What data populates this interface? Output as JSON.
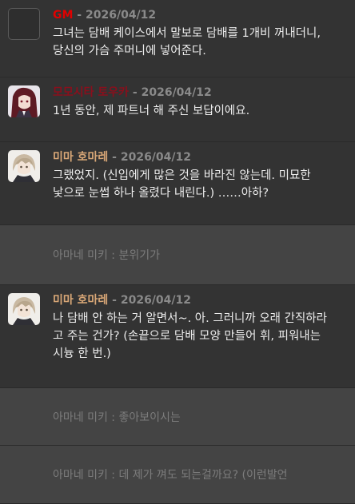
{
  "messages": [
    {
      "kind": "chat",
      "speaker": "GM",
      "speaker_color": "#e10000",
      "timestamp": " - 2026/04/12",
      "text": "그녀는 담배 케이스에서 말보로 담배를 1개비 꺼내더니,\n당신의 가슴 주머니에 넣어준다.",
      "avatar": "gm-avatar-box",
      "height": 97
    },
    {
      "kind": "chat",
      "speaker": "모모시타 토우카",
      "speaker_color": "#8a0f1c",
      "timestamp": " - 2026/04/12",
      "text": "1년 동안, 제 파트너 해 주신 보답이에요.",
      "avatar": "dark-red-hair-woman-avatar",
      "height": 81
    },
    {
      "kind": "chat",
      "speaker": "미마 호마레",
      "speaker_color": "#d9a777",
      "timestamp": " - 2026/04/12",
      "text": "그랬었지. (신입에게 많은 것을 바라진 않는데. 미묘한\n낯으로 눈썹 하나 올렸다 내린다.) ……아하?",
      "avatar": "ash-blonde-young-man-avatar",
      "height": 104
    },
    {
      "kind": "ooc",
      "text": "아마네 미키 : 분위기가",
      "height": 75
    },
    {
      "kind": "chat",
      "speaker": "미마 호마레",
      "speaker_color": "#d9a777",
      "timestamp": " - 2026/04/12",
      "text": "나 담배 안 하는 거 알면서~. 아. 그러니까 오래 간직하라\n고 주는 건가? (손끝으로 담배 모양 만들어 휘, 피워내는\n시늉 한 번.)",
      "avatar": "ash-blonde-young-man-avatar",
      "height": 129
    },
    {
      "kind": "ooc",
      "text": "아마네 미키 : 좋아보이시는",
      "height": 72
    },
    {
      "kind": "ooc",
      "text": "아마네 미키 : 데 제가 껴도 되는걸까요? (이런발언",
      "height": 73
    }
  ]
}
